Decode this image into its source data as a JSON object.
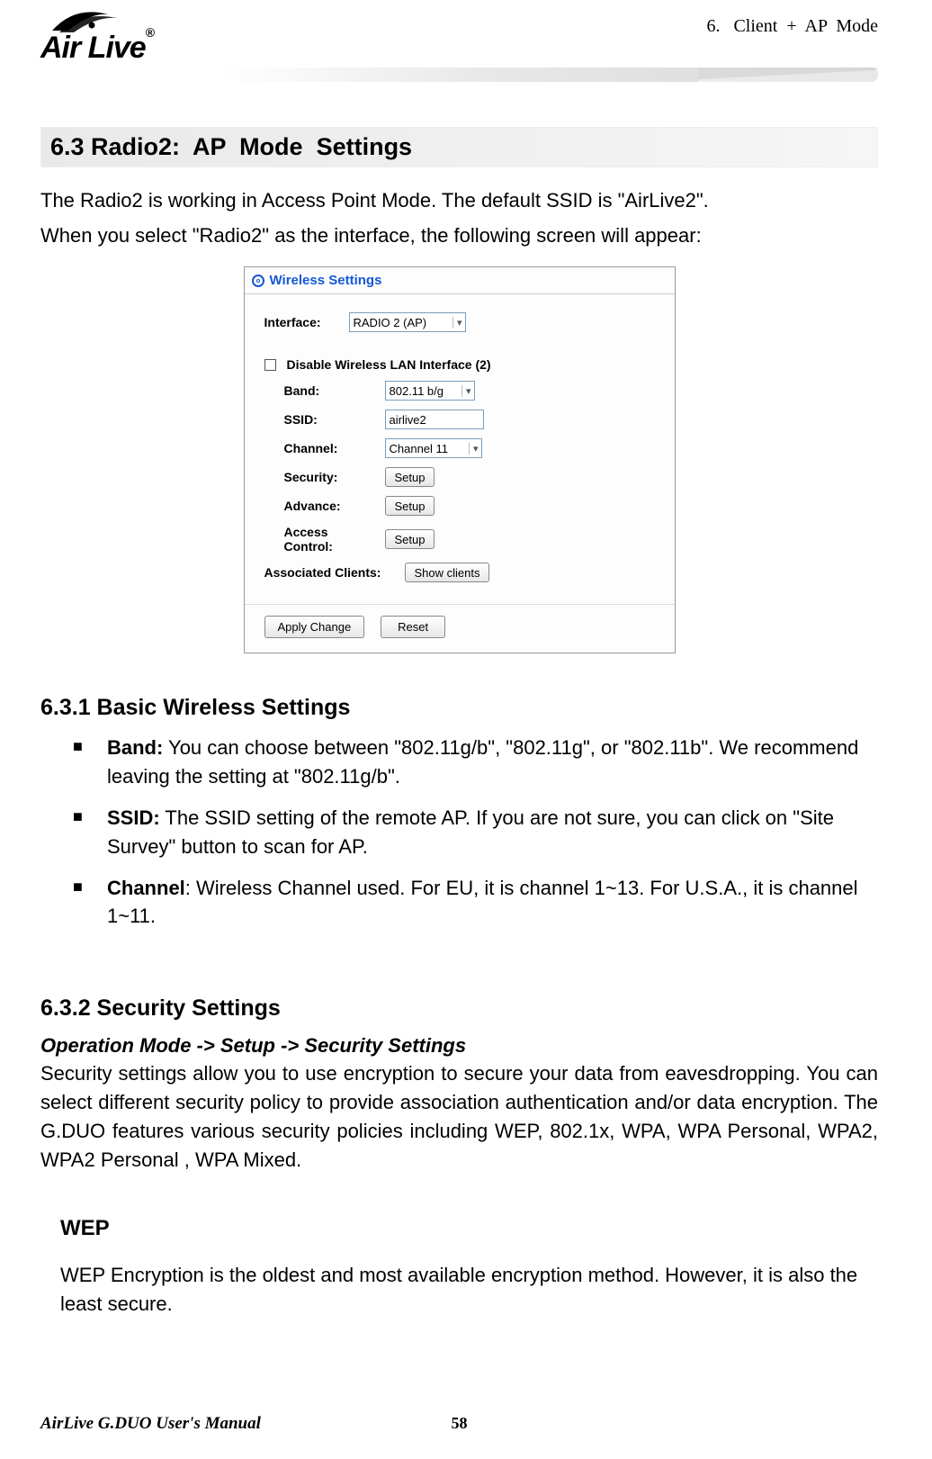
{
  "header": {
    "chapter": "6.   Client  +  AP  Mode",
    "logo_text": "Air Live",
    "logo_reg": "®"
  },
  "section": {
    "heading": "6.3 Radio2:  AP  Mode  Settings",
    "intro1": "The Radio2 is working in Access Point Mode.    The default SSID is \"AirLive2\".",
    "intro2": "When you select \"Radio2\" as the interface, the following screen will appear:"
  },
  "screenshot": {
    "title": "Wireless Settings",
    "interface_label": "Interface:",
    "interface_value": "RADIO 2 (AP)",
    "disable_label": "Disable Wireless LAN Interface (2)",
    "rows": {
      "band_label": "Band:",
      "band_value": "802.11 b/g",
      "ssid_label": "SSID:",
      "ssid_value": "airlive2",
      "channel_label": "Channel:",
      "channel_value": "Channel 11",
      "security_label": "Security:",
      "security_btn": "Setup",
      "advance_label": "Advance:",
      "advance_btn": "Setup",
      "ac_label": "Access Control:",
      "ac_btn": "Setup",
      "assoc_label": "Associated Clients:",
      "assoc_btn": "Show clients"
    },
    "apply_btn": "Apply Change",
    "reset_btn": "Reset"
  },
  "basic": {
    "heading": "6.3.1 Basic Wireless Settings",
    "bullets": [
      {
        "label": "Band:",
        "text": "   You can choose between \"802.11g/b\", \"802.11g\", or \"802.11b\".    We recommend leaving the setting at \"802.11g/b\"."
      },
      {
        "label": "SSID:",
        "text": "   The SSID setting of the remote AP.    If you are not sure, you can click on \"Site Survey\" button to scan for AP."
      },
      {
        "label": "Channel",
        "text": ":    Wireless Channel used.    For EU, it is channel 1~13.    For U.S.A., it is channel 1~11."
      }
    ]
  },
  "security": {
    "heading": "6.3.2 Security Settings",
    "nav": "Operation Mode -> Setup -> Security Settings",
    "body": "Security settings allow you to use encryption to secure your data from eavesdropping.  You can select different security policy to provide association authentication and/or data encryption.   The G.DUO features various security policies including WEP, 802.1x, WPA, WPA Personal, WPA2, WPA2 Personal , WPA Mixed."
  },
  "wep": {
    "heading": "WEP",
    "body": "WEP Encryption is the oldest and most available encryption method.    However, it is also the least secure."
  },
  "footer": {
    "left": "AirLive G.DUO User's Manual",
    "page": "58"
  }
}
